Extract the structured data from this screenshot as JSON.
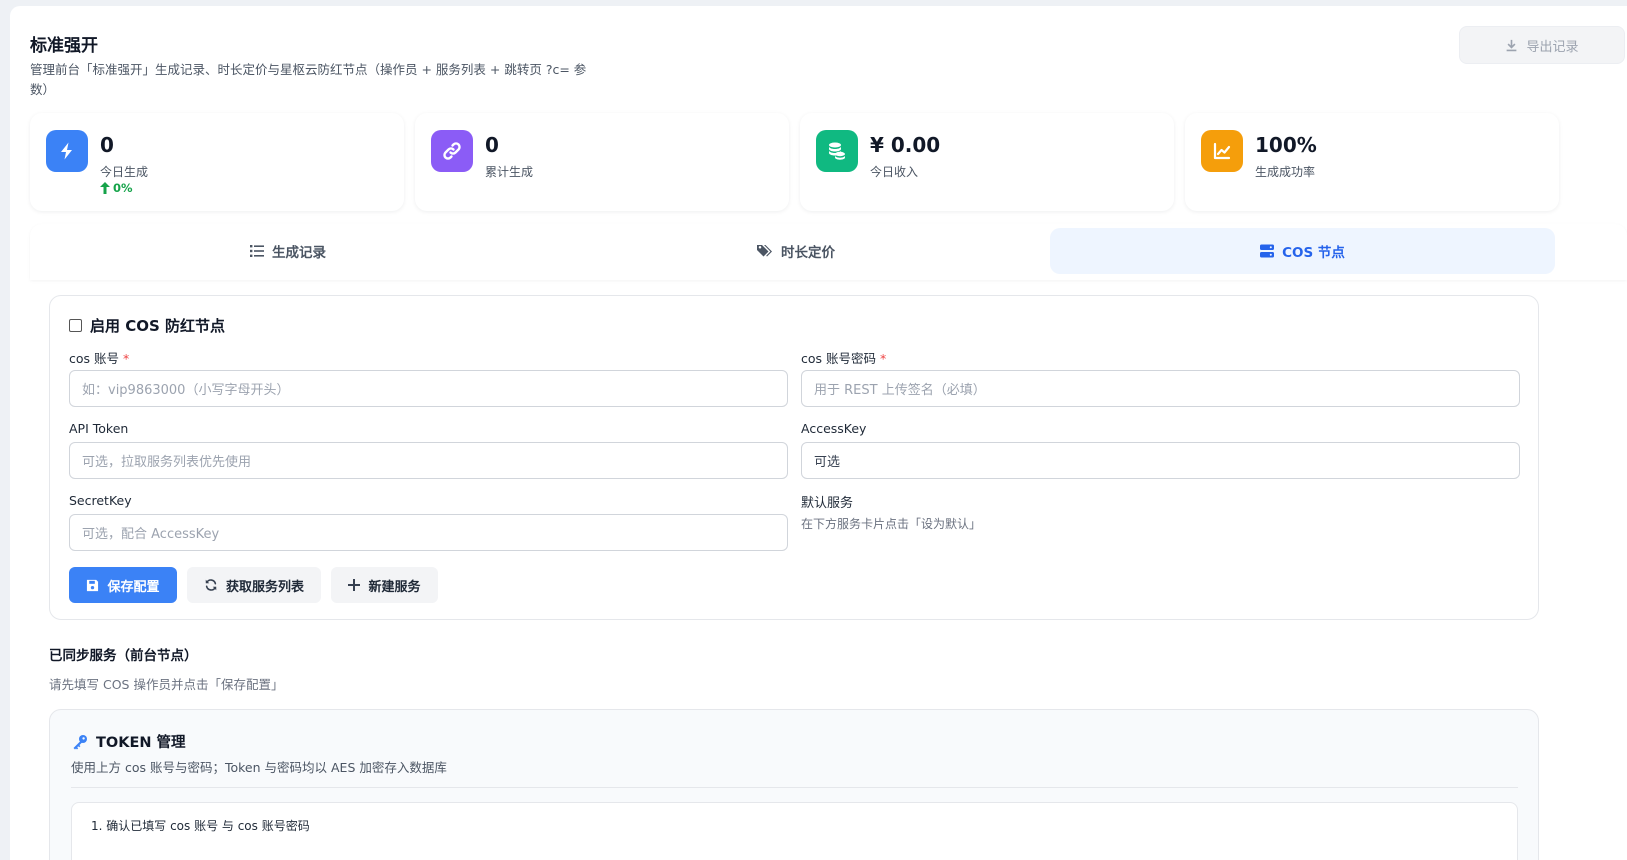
{
  "header": {
    "title": "标准强开",
    "description": "管理前台「标准强开」生成记录、时长定价与星枢云防红节点（操作员 + 服务列表 + 跳转页 ?c= 参数）",
    "export_label": "导出记录"
  },
  "stats": [
    {
      "value": "0",
      "label": "今日生成",
      "trend": "0%",
      "icon": "bolt-icon",
      "color": "#3b82f6"
    },
    {
      "value": "0",
      "label": "累计生成",
      "icon": "link-icon",
      "color": "#8b5cf6"
    },
    {
      "value": "¥ 0.00",
      "label": "今日收入",
      "icon": "coins-icon",
      "color": "#10b981"
    },
    {
      "value": "100%",
      "label": "生成成功率",
      "icon": "chart-line-icon",
      "color": "#f59e0b"
    }
  ],
  "tabs": [
    {
      "label": "生成记录",
      "icon": "list-icon",
      "active": false
    },
    {
      "label": "时长定价",
      "icon": "tags-icon",
      "active": false
    },
    {
      "label": "COS 节点",
      "icon": "server-icon",
      "active": true
    }
  ],
  "cos_form": {
    "enable_label": "启用 COS 防红节点",
    "account_label": "cos 账号",
    "account_placeholder": "如：vip9863000（小写字母开头）",
    "password_label": "cos 账号密码",
    "password_placeholder": "用于 REST 上传签名（必填）",
    "api_token_label": "API Token",
    "api_token_placeholder": "可选，拉取服务列表优先使用",
    "access_key_label": "AccessKey",
    "access_key_value": "可选",
    "secret_key_label": "SecretKey",
    "secret_key_placeholder": "可选，配合 AccessKey",
    "default_service_label": "默认服务",
    "default_service_hint": "在下方服务卡片点击「设为默认」",
    "required_mark": "*",
    "save_label": "保存配置",
    "fetch_label": "获取服务列表",
    "new_label": "新建服务"
  },
  "synced": {
    "title": "已同步服务（前台节点）",
    "hint": "请先填写 COS 操作员并点击「保存配置」"
  },
  "token": {
    "title": "TOKEN 管理",
    "description": "使用上方 cos 账号与密码；Token 与密码均以 AES 加密存入数据库",
    "step1": "1. 确认已填写 cos 账号 与 cos 账号密码"
  },
  "colors": {
    "accent": "#3b82f6",
    "success": "#16a34a",
    "required": "#ef4444"
  }
}
